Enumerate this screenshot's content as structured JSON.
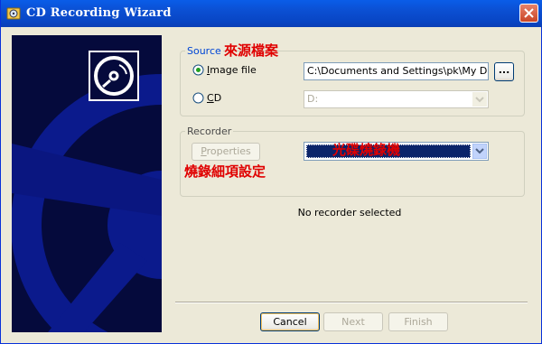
{
  "window": {
    "title": "CD Recording Wizard"
  },
  "source": {
    "group_label": "Source",
    "annotation": "來源檔案",
    "image_file_label": "Image file",
    "image_file_mnemonic": "I",
    "image_path": "C:\\Documents and Settings\\pk\\My Docume",
    "browse_label": "...",
    "cd_label": "CD",
    "cd_mnemonic": "C",
    "cd_drive": "D:"
  },
  "recorder": {
    "group_label": "Recorder",
    "properties_label": "Properties",
    "properties_mnemonic": "P",
    "properties_annotation": "燒錄細項設定",
    "drive_annotation": "光碟燒錄機",
    "status": "No recorder selected"
  },
  "buttons": {
    "cancel": "Cancel",
    "next": "Next",
    "finish": "Finish"
  },
  "colors": {
    "titlebar": "#0a5de8",
    "panel": "#050a3c",
    "annotation": "#e00000",
    "selection": "#0a246a"
  }
}
